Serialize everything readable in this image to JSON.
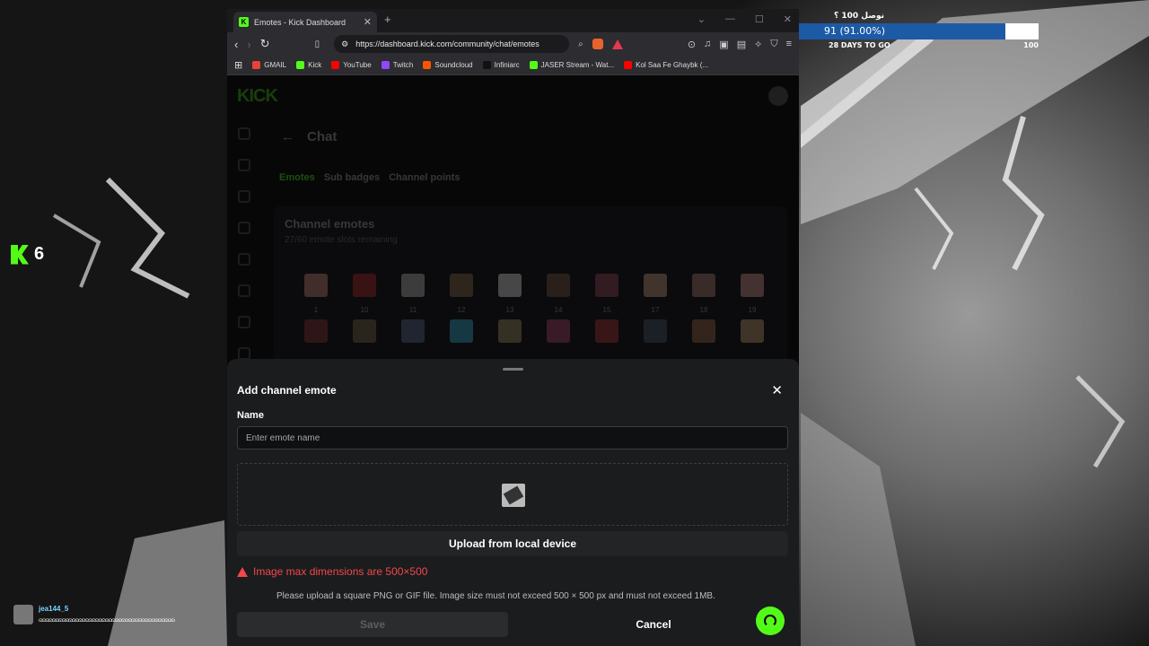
{
  "overlay": {
    "kick_count": "6",
    "goal_title": "نوصل 100 ؟",
    "goal_progress_text": "91 (91.00%)",
    "goal_fraction": 0.91,
    "goal_days": "28 DAYS TO GO",
    "goal_max": "100",
    "chat_user": "jea144_5",
    "chat_message": "ɷɷɷɷɷɷɷɷɷɷɷɷɷɷɷɷɷɷɷɷɷɷɷɷɷɷɷɷɷɷɷɷɷɷɷɷɷɷɷɷɷ"
  },
  "browser": {
    "tab_title": "Emotes - Kick Dashboard",
    "url": "https://dashboard.kick.com/community/chat/emotes",
    "bookmarks": [
      "GMAIL",
      "Kick",
      "YouTube",
      "Twitch",
      "Soundcloud",
      "Infiniarc",
      "JASER Stream - Wat...",
      "Kol Saa Fe Ghaybk (..."
    ],
    "bookmark_colors": [
      "#ea4335",
      "#53fc18",
      "#ff0000",
      "#9146ff",
      "#ff5500",
      "#111111",
      "#53fc18",
      "#ff0000"
    ]
  },
  "page": {
    "logo": "KICK",
    "back_title": "Chat",
    "tabs": [
      "Emotes",
      "Sub badges",
      "Channel points"
    ],
    "panel_title": "Channel emotes",
    "panel_sub": "27/60 emote slots remaining",
    "emote_labels": [
      "1",
      "10",
      "11",
      "12",
      "13",
      "14",
      "15",
      "17",
      "18",
      "19"
    ],
    "emote_colors": [
      "#c98a7a",
      "#b02a2a",
      "#bbbbbb",
      "#8a6a4a",
      "#dddddd",
      "#7a5a4a",
      "#9a4a5a",
      "#c8a080",
      "#b08070",
      "#d09a8a",
      "#8a3a3a",
      "#7a6a4a",
      "#5a6a8a",
      "#3aaacc",
      "#a09060",
      "#aa4a6a",
      "#aa3a3a",
      "#4a5a6a",
      "#a06a4a",
      "#c0a070"
    ]
  },
  "modal": {
    "title": "Add channel emote",
    "name_label": "Name",
    "name_placeholder": "Enter emote name",
    "upload_label": "Upload from local device",
    "error": "Image max dimensions are 500×500",
    "hint": "Please upload a square PNG or GIF file. Image size must not exceed 500 × 500 px and must not exceed 1MB.",
    "save_label": "Save",
    "cancel_label": "Cancel"
  }
}
